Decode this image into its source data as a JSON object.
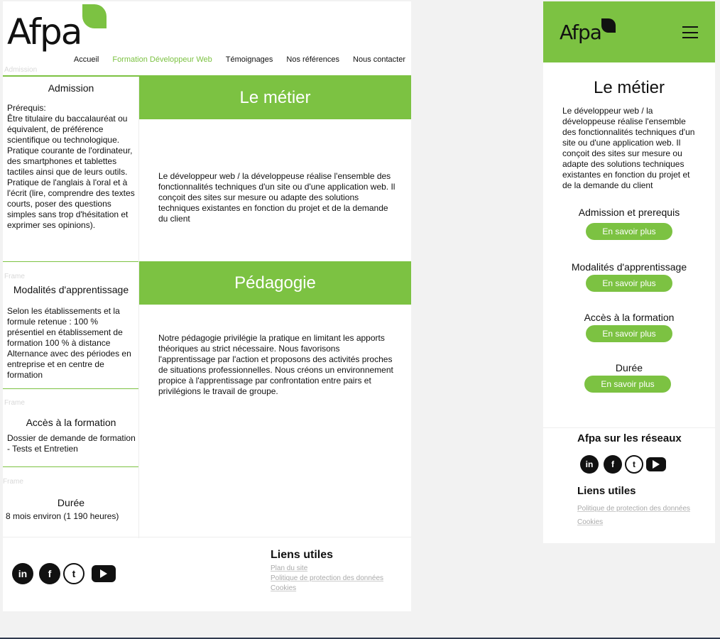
{
  "brand": {
    "name": "Afpa",
    "accent": "#7cc242",
    "text": "#111111"
  },
  "nav": [
    {
      "label": "Accueil",
      "active": false
    },
    {
      "label": "Formation Développeur Web",
      "active": true
    },
    {
      "label": "Témoignages",
      "active": false
    },
    {
      "label": "Nos références",
      "active": false
    },
    {
      "label": "Nous contacter",
      "active": false
    }
  ],
  "ghost": {
    "admission": "Admission",
    "frame1": "Frame",
    "frame2": "Frame",
    "frame3": "Frame"
  },
  "sidebar": {
    "admission": {
      "title": "Admission",
      "text": "Prérequis:\nÊtre titulaire du baccalauréat ou équivalent, de préférence scientifique ou technologique. Pratique courante de l'ordinateur, des smartphones et tablettes tactiles ainsi que de leurs outils. Pratique de l'anglais à l'oral et à l'écrit (lire, comprendre des textes courts, poser des questions simples sans trop d'hésitation et exprimer ses opinions)."
    },
    "modalites": {
      "title": "Modalités d'apprentissage",
      "text": "Selon les établissements et la formule retenue : 100 % présentiel en établissement de formation 100 % à distance Alternance avec des périodes en entreprise et en centre de formation"
    },
    "acces": {
      "title": "Accès à la formation",
      "text": "Dossier de demande de formation - Tests et Entretien"
    },
    "duree": {
      "title": "Durée",
      "text": "8 mois environ (1 190 heures)"
    }
  },
  "main": {
    "metier": {
      "title": "Le métier",
      "text": "Le développeur web / la développeuse réalise l'ensemble des fonctionnalités techniques d'un site ou d'une application web. Il conçoit des sites sur mesure ou adapte des solutions techniques existantes en fonction du projet et de la demande du client"
    },
    "pedagogie": {
      "title": "Pédagogie",
      "text": "Notre pédagogie privilégie la pratique en limitant les apports théoriques au strict nécessaire. Nous favorisons l'apprentissage par l'action et proposons des activités proches de situations professionnelles. Nous créons un environnement propice à l'apprentissage par confrontation entre pairs et privilégions le travail de groupe."
    }
  },
  "footer": {
    "social_icons": [
      "linkedin-icon",
      "facebook-icon",
      "twitter-icon",
      "youtube-icon"
    ],
    "links_title": "Liens utiles",
    "links": [
      "Plan du site",
      "Politique de protection des données",
      "Cookies"
    ]
  },
  "mobile": {
    "title": "Le métier",
    "text": "Le développeur web / la développeuse réalise l'ensemble des fonctionnalités techniques d'un site ou d'une application web. Il conçoit des sites sur mesure ou adapte des solutions techniques existantes en fonction du projet et de la demande du client",
    "items": [
      {
        "label": "Admission et prerequis"
      },
      {
        "label": "Modalités d'apprentissage"
      },
      {
        "label": "Accès à la formation"
      },
      {
        "label": "Durée"
      }
    ],
    "button_label": "En savoir plus",
    "social_title": "Afpa sur les réseaux",
    "links_title": "Liens utiles",
    "links": [
      "Politique de protection des données",
      "Cookies"
    ]
  }
}
